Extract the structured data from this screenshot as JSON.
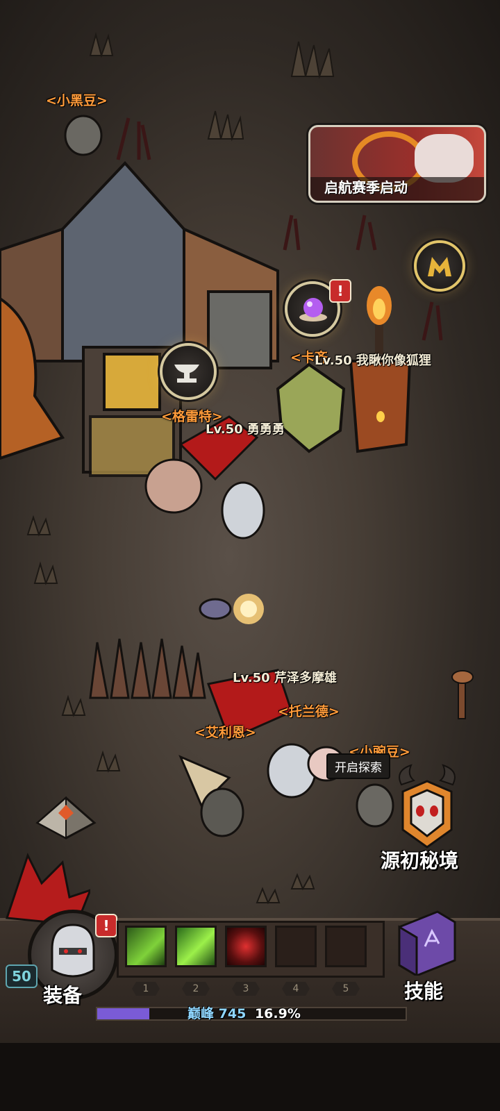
{
  "event_banner": {
    "label": "启航赛季启动"
  },
  "npc_names": {
    "xiaoheidou": "<小黑豆>",
    "kaqi": "<卡齐",
    "gelei": "<格雷特>",
    "tuolande": "<托兰德>",
    "ailien": "<艾利恩>",
    "xiaowandou": "<小豌豆>"
  },
  "players": {
    "fox": "Lv.50 我瞅你像狐狸",
    "yong": "Lv.50 勇勇勇",
    "ruize": "Lv.50 芹泽多摩雄"
  },
  "explore_bubble": "开启探索",
  "dungeon_label": "源初秘境",
  "hud": {
    "equip_label": "装备",
    "skill_label": "技能",
    "level": "50",
    "alert": "!",
    "slot_numbers": [
      "1",
      "2",
      "3",
      "4",
      "5"
    ],
    "peak_label": "巅峰",
    "peak_value": "745",
    "progress_text": "16.9%",
    "progress": 0.169
  },
  "colors": {
    "name_orange": "#ff9b3a",
    "progress_fill": "#7a5bd6",
    "gold": "#e7b43a"
  },
  "icons": [
    "anvil-icon",
    "crystal-orb-icon",
    "m-medal-icon",
    "ram-skull-icon",
    "spellbook-icon",
    "knight-portrait-icon"
  ]
}
